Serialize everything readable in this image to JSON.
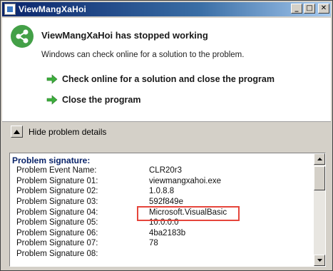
{
  "window": {
    "title": "ViewMangXaHoi",
    "minimize_glyph": "_",
    "maximize_glyph": "□",
    "close_glyph": "✕"
  },
  "header": {
    "heading": "ViewMangXaHoi has stopped working",
    "subtext": "Windows can check online for a solution to the problem."
  },
  "options": [
    {
      "label": "Check online for a solution and close the program"
    },
    {
      "label": "Close the program"
    }
  ],
  "details_toggle": {
    "label": "Hide problem details"
  },
  "details": {
    "title": "Problem signature:",
    "rows": [
      {
        "name": "Problem Event Name:",
        "value": "CLR20r3"
      },
      {
        "name": "Problem Signature 01:",
        "value": "viewmangxahoi.exe"
      },
      {
        "name": "Problem Signature 02:",
        "value": "1.0.8.8"
      },
      {
        "name": "Problem Signature 03:",
        "value": "592f849e"
      },
      {
        "name": "Problem Signature 04:",
        "value": "Microsoft.VisualBasic"
      },
      {
        "name": "Problem Signature 05:",
        "value": "10.0.0.0"
      },
      {
        "name": "Problem Signature 06:",
        "value": "4ba2183b"
      },
      {
        "name": "Problem Signature 07:",
        "value": "78"
      },
      {
        "name": "Problem Signature 08:",
        "value": ""
      }
    ]
  },
  "colors": {
    "titlebar_start": "#0a246a",
    "app_icon": "#43a047",
    "arrow": "#3cae3c",
    "highlight": "#e5453b",
    "signature_title": "#0a246a"
  }
}
